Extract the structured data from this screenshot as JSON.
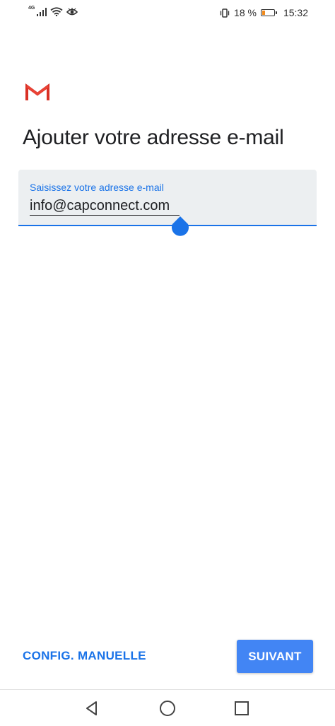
{
  "status_bar": {
    "network_type": "4G",
    "battery_percent_label": "18 %",
    "battery_level": 0.18,
    "time": "15:32",
    "icons": [
      "signal-icon",
      "wifi-icon",
      "eye-icon",
      "vibrate-icon",
      "battery-icon"
    ]
  },
  "app": {
    "logo": "gmail-logo",
    "colors": {
      "accent": "#1a73e8",
      "button": "#4285f4",
      "logo_red": "#d93025",
      "field_bg": "#eceff1"
    }
  },
  "page": {
    "title": "Ajouter votre adresse e-mail"
  },
  "email_field": {
    "label": "Saisissez votre adresse e-mail",
    "value": "info@capconnect.com"
  },
  "actions": {
    "manual_config_label": "CONFIG. MANUELLE",
    "next_label": "SUIVANT"
  },
  "nav_bar": {
    "buttons": [
      "back-icon",
      "home-icon",
      "recents-icon"
    ]
  }
}
